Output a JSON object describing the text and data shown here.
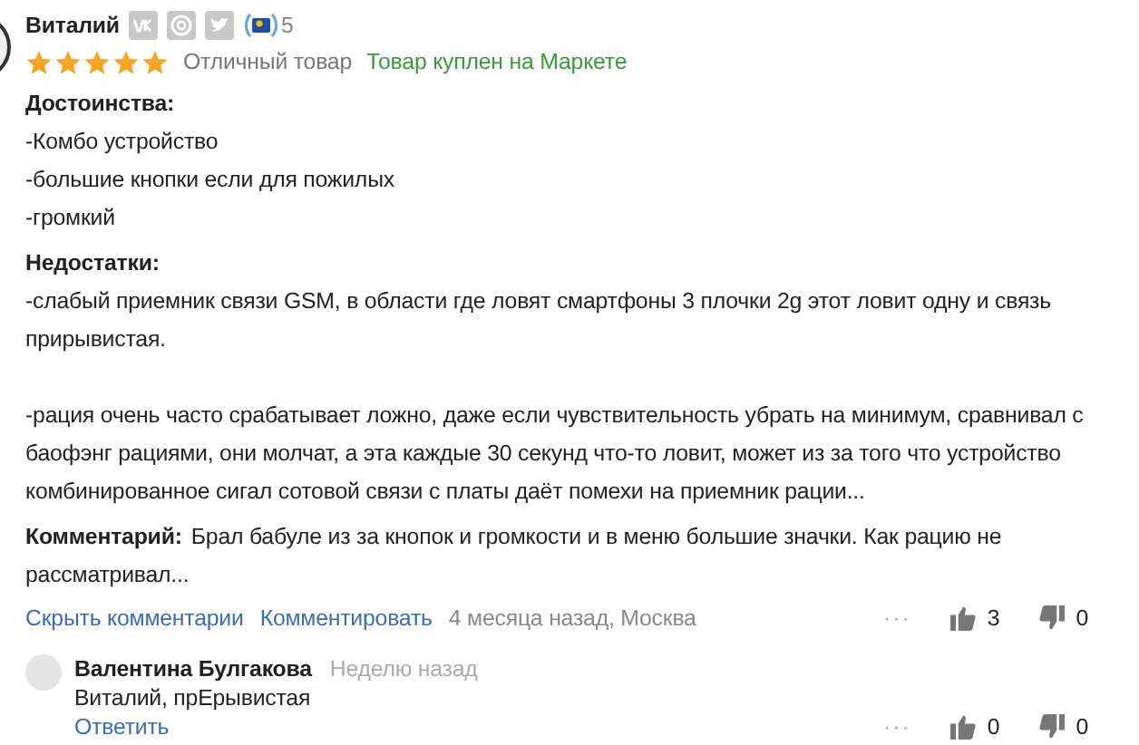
{
  "review": {
    "author": "Виталий",
    "level": "5",
    "stars": 5,
    "rating_text": "Отличный товар",
    "purchase_note": "Товар куплен на Маркете",
    "sections": [
      {
        "title": "Достоинства:",
        "paragraphs": [
          [
            "-Комбо устройство",
            "-большие кнопки если для пожилых",
            "-громкий"
          ]
        ]
      },
      {
        "title": "Недостатки:",
        "paragraphs": [
          [
            "-слабый приемник связи GSM, в области где ловят смартфоны 3 плочки 2g этот ловит одну и связь прирывистая."
          ],
          [
            "-рация очень часто срабатывает ложно, даже если чувствительность убрать на минимум, сравнивал с баофэнг рациями, они молчат, а эта каждые 30 секунд что-то ловит, может из за того что устройство комбинированное сигал сотовой связи с платы даёт помехи на приемник рации..."
          ]
        ]
      }
    ],
    "comment": {
      "label": "Комментарий:",
      "text": "Брал бабуле из за кнопок и громкости и в меню большие значки. Как рацию не рассматривал..."
    },
    "hide_comments": "Скрыть комментарии",
    "add_comment": "Комментировать",
    "meta": "4 месяца назад, Москва",
    "more": "···",
    "likes": "3",
    "dislikes": "0"
  },
  "reply": {
    "author": "Валентина Булгакова",
    "time": "Неделю назад",
    "text": "Виталий, прЕрывистая",
    "reply_link": "Ответить",
    "more": "···",
    "likes": "0",
    "dislikes": "0"
  }
}
